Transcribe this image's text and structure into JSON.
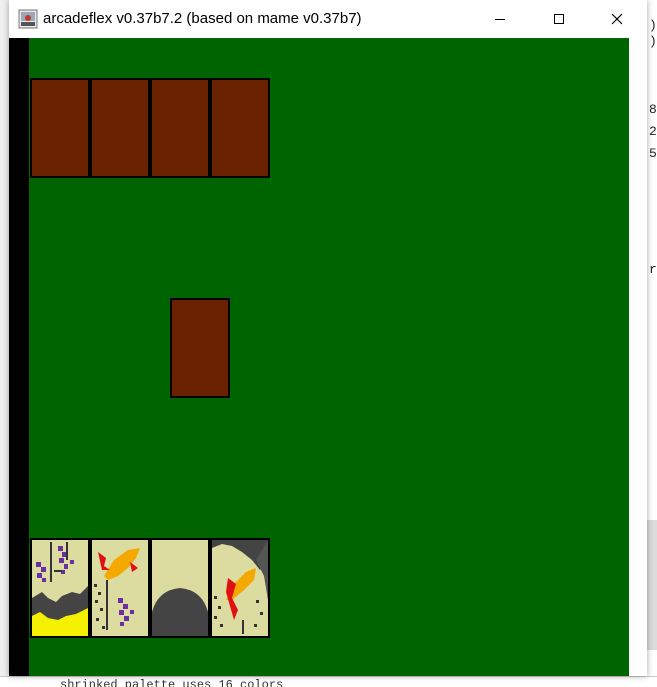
{
  "window": {
    "title": "arcadeflex v0.37b7.2 (based on mame v0.37b7)",
    "controls": {
      "minimize": "minimize-icon",
      "maximize": "maximize-icon",
      "close": "close-icon"
    }
  },
  "background_app": {
    "right_chars": [
      ")",
      ")",
      "8",
      "2",
      "5",
      "r"
    ],
    "bottom_text": "shrinked palette uses 16 colors"
  },
  "game": {
    "felt_color": "#006400",
    "card_back_color": "#6b2200",
    "card_face_color": "#dcdba0",
    "opponent_hand_count": 4,
    "center_card": "face-down",
    "player_hand": [
      {
        "icon": "wisteria-card-icon"
      },
      {
        "icon": "cuckoo-wisteria-card-icon"
      },
      {
        "icon": "plain-card-icon"
      },
      {
        "icon": "bird-card-icon"
      }
    ]
  }
}
